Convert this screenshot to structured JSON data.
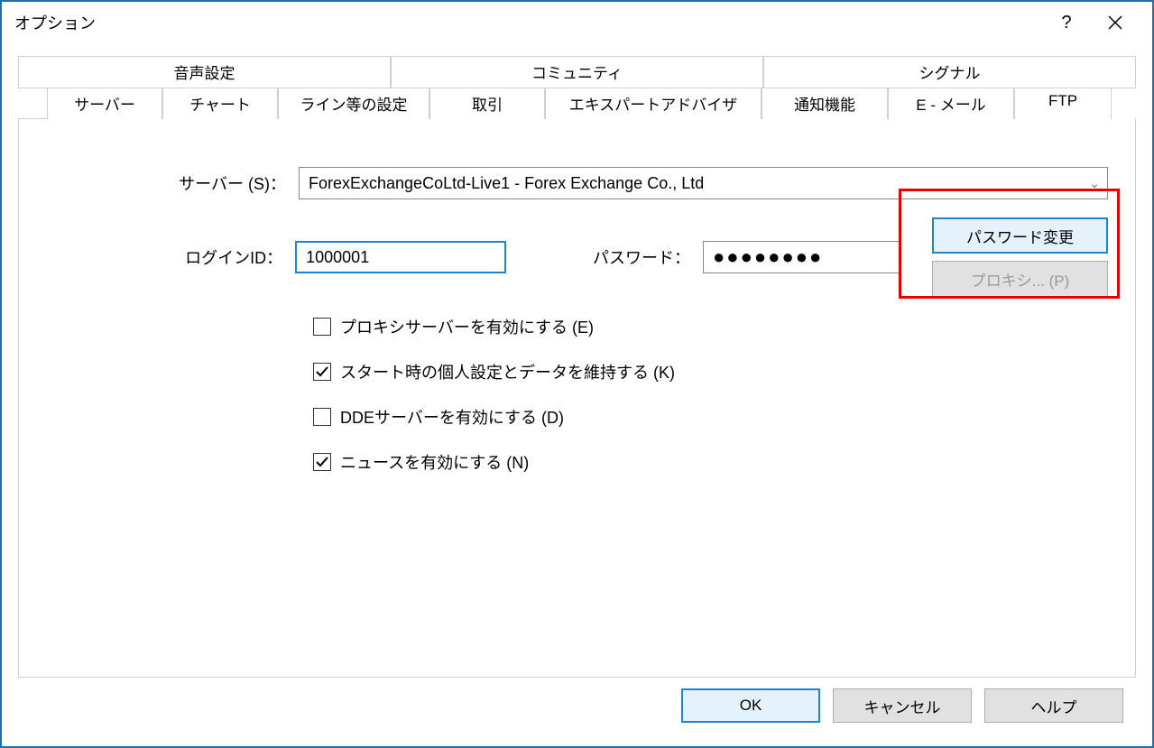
{
  "window": {
    "title": "オプション",
    "help_icon": "?",
    "close_icon": "✕"
  },
  "tabs_top": [
    {
      "label": "音声設定"
    },
    {
      "label": "コミュニティ"
    },
    {
      "label": "シグナル"
    }
  ],
  "tabs_bottom": [
    {
      "label": "サーバー",
      "active": true
    },
    {
      "label": "チャート"
    },
    {
      "label": "ライン等の設定"
    },
    {
      "label": "取引"
    },
    {
      "label": "エキスパートアドバイザ"
    },
    {
      "label": "通知機能"
    },
    {
      "label": "E - メール"
    },
    {
      "label": "FTP"
    }
  ],
  "form": {
    "server_label": "サーバー (S)：",
    "server_value": "ForexExchangeCoLtd-Live1 - Forex Exchange Co., Ltd",
    "login_label": "ログインID：",
    "login_value": "1000001",
    "password_label": "パスワード：",
    "password_value": "●●●●●●●●",
    "change_pw_btn": "パスワード変更",
    "proxy_btn": "プロキシ... (P)"
  },
  "checkboxes": [
    {
      "label": "プロキシサーバーを有効にする (E)",
      "checked": false
    },
    {
      "label": "スタート時の個人設定とデータを維持する (K)",
      "checked": true
    },
    {
      "label": "DDEサーバーを有効にする (D)",
      "checked": false
    },
    {
      "label": "ニュースを有効にする (N)",
      "checked": true
    }
  ],
  "footer": {
    "ok": "OK",
    "cancel": "キャンセル",
    "help": "ヘルプ"
  }
}
